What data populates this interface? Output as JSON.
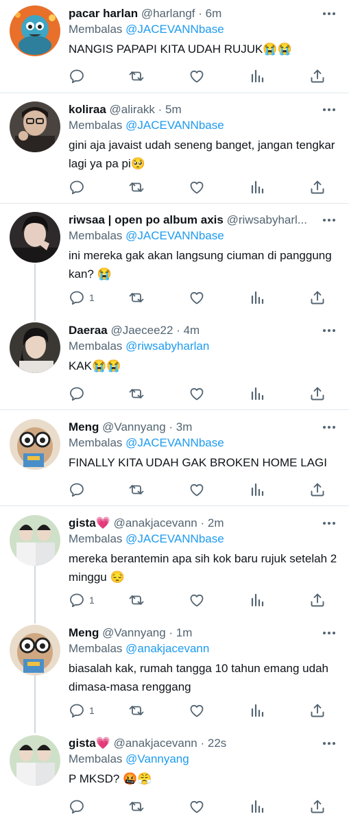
{
  "reply_prefix": "Membalas",
  "tweets": [
    {
      "name": "pacar harlan",
      "emoji": "",
      "handle": "@harlangf",
      "time": "· 6m",
      "reply_to": "@JACEVANNbase",
      "text": "NANGIS PAPAPI KITA UDAH RUJUK😭😭",
      "reply_count": ""
    },
    {
      "name": "koliraa",
      "emoji": "",
      "handle": "@alirakk",
      "time": "· 5m",
      "reply_to": "@JACEVANNbase",
      "text": "gini aja javaist udah seneng banget, jangan tengkar lagi ya pa pi🥺",
      "reply_count": ""
    },
    {
      "name": "riwsaa | open po album axis",
      "emoji": "",
      "handle": "@riwsabyharl...",
      "time": "",
      "reply_to": "@JACEVANNbase",
      "text": "ini mereka gak akan langsung ciuman di panggung kan? 😭",
      "reply_count": "1"
    },
    {
      "name": "Daeraa",
      "emoji": "",
      "handle": "@Jaecee22",
      "time": "· 4m",
      "reply_to": "@riwsabyharlan",
      "text": "KAK😭😭",
      "reply_count": ""
    },
    {
      "name": "Meng",
      "emoji": "",
      "handle": "@Vannyang",
      "time": "· 3m",
      "reply_to": "@JACEVANNbase",
      "text": "FINALLY KITA UDAH GAK BROKEN HOME LAGI",
      "reply_count": ""
    },
    {
      "name": "gista",
      "emoji": "💗",
      "handle": "@anakjacevann",
      "time": "· 2m",
      "reply_to": "@JACEVANNbase",
      "text": "mereka berantemin apa sih kok baru rujuk setelah 2 minggu 😔",
      "reply_count": "1"
    },
    {
      "name": "Meng",
      "emoji": "",
      "handle": "@Vannyang",
      "time": "· 1m",
      "reply_to": "@anakjacevann",
      "text": "biasalah kak, rumah tangga 10 tahun emang udah dimasa-masa renggang",
      "reply_count": "1"
    },
    {
      "name": "gista",
      "emoji": "💗",
      "handle": "@anakjacevann",
      "time": "· 22s",
      "reply_to": "@Vannyang",
      "text": "P MKSD? 🤬😤",
      "reply_count": ""
    }
  ],
  "colors": {
    "accent": "#1d9bf0",
    "secondary_text": "#536471",
    "divider": "#e1e8ed",
    "thread_line": "#cfd9de"
  },
  "icons": {
    "reply": "reply-icon",
    "retweet": "retweet-icon",
    "like": "heart-icon",
    "stats": "analytics-icon",
    "share": "share-icon",
    "more": "more-icon"
  }
}
